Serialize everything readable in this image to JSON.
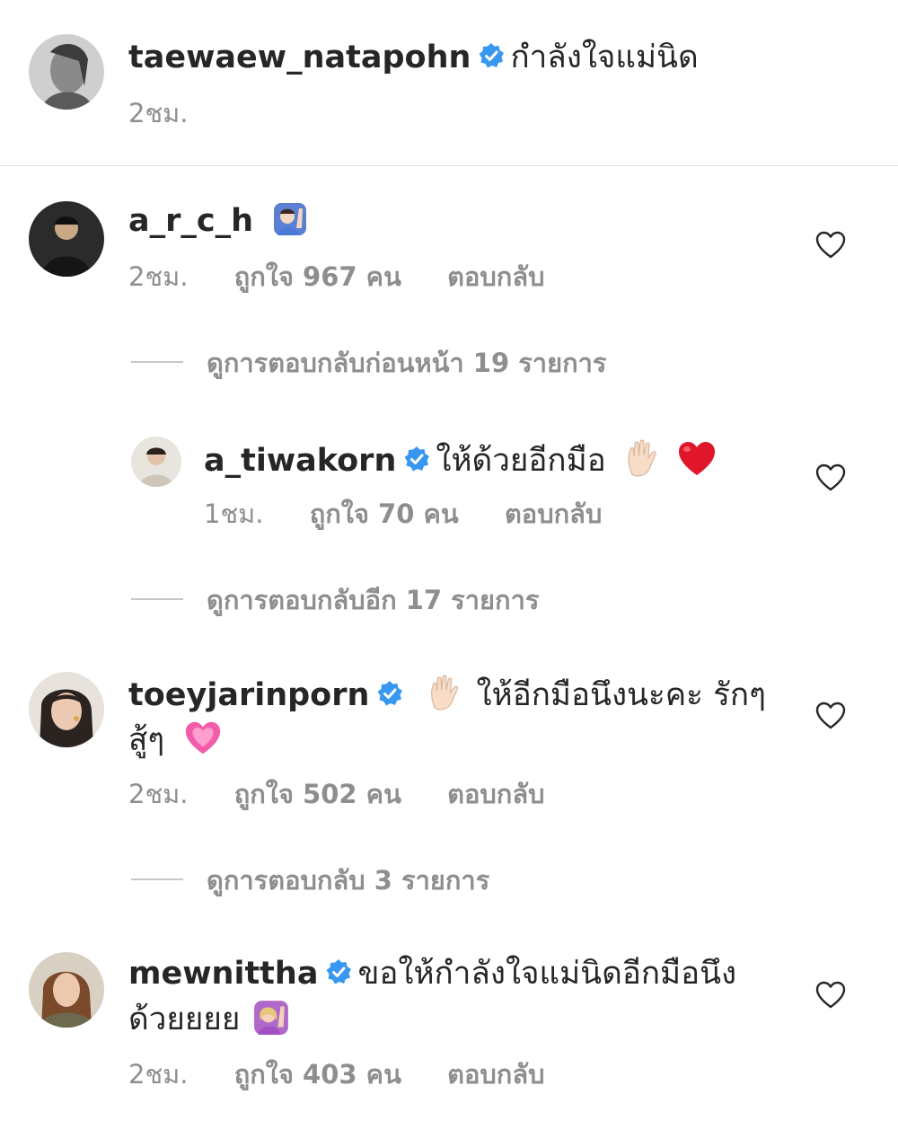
{
  "caption": {
    "username": "taewaew_natapohn",
    "text": "กำลังใจแม่นิด",
    "time": "2ชม."
  },
  "comments": [
    {
      "username": "a_r_c_h",
      "emoji": "person-raising-hand-emoji",
      "time": "2ชม.",
      "likes": "ถูกใจ 967 คน",
      "reply_label": "ตอบกลับ",
      "view_replies": "ดูการตอบกลับก่อนหน้า 19 รายการ",
      "reply": {
        "username": "a_tiwakorn",
        "text": "ให้ด้วยอีกมือ",
        "emojis": [
          "raised-hand-emoji",
          "red-heart-emoji"
        ],
        "time": "1ชม.",
        "likes": "ถูกใจ 70 คน",
        "reply_label": "ตอบกลับ"
      },
      "view_more_replies": "ดูการตอบกลับอีก 17 รายการ"
    },
    {
      "username": "toeyjarinporn",
      "text_line1": "ให้อีกมือนึงนะคะ รักๆ",
      "text_line2": "สู้ๆ",
      "emojis": [
        "raised-hand-emoji",
        "pink-heart-emoji"
      ],
      "time": "2ชม.",
      "likes": "ถูกใจ 502 คน",
      "reply_label": "ตอบกลับ",
      "view_replies": "ดูการตอบกลับ 3 รายการ"
    },
    {
      "username": "mewnittha",
      "text_line1": "ขอให้กำลังใจแม่นิดอีกมือนึง",
      "text_line2": "ด้วยยยย",
      "emoji": "person-raising-hand-emoji",
      "time": "2ชม.",
      "likes": "ถูกใจ 403 คน",
      "reply_label": "ตอบกลับ"
    }
  ],
  "colors": {
    "text": "#262626",
    "secondary": "#8e8e8e",
    "verified": "#3897f0",
    "divider": "#dbdbdb"
  }
}
